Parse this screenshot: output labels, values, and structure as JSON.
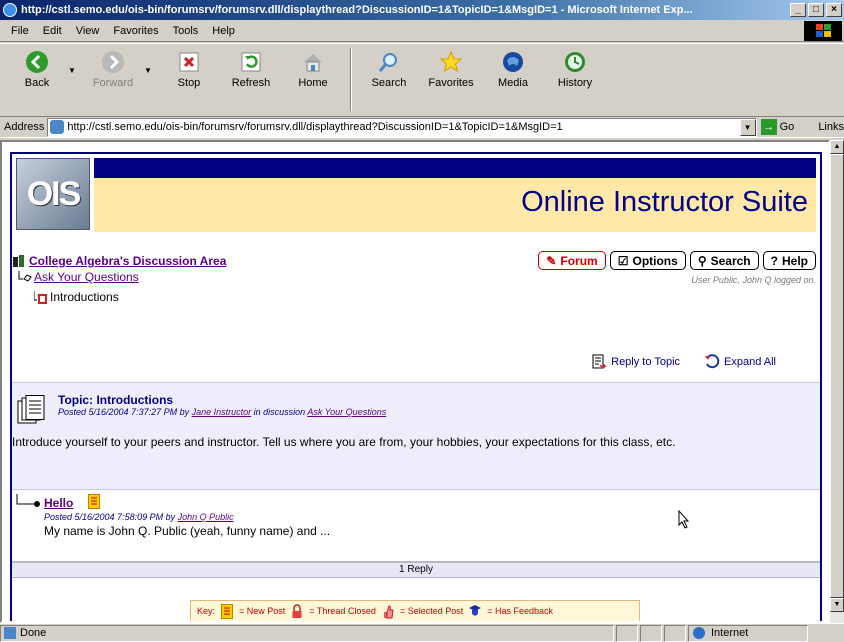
{
  "window": {
    "title": "http://cstl.semo.edu/ois-bin/forumsrv/forumsrv.dll/displaythread?DiscussionID=1&TopicID=1&MsgID=1 - Microsoft Internet Exp..."
  },
  "menu": [
    "File",
    "Edit",
    "View",
    "Favorites",
    "Tools",
    "Help"
  ],
  "toolbar": {
    "back": "Back",
    "forward": "Forward",
    "stop": "Stop",
    "refresh": "Refresh",
    "home": "Home",
    "search": "Search",
    "favorites": "Favorites",
    "media": "Media",
    "history": "History"
  },
  "address": {
    "label": "Address",
    "url": "http://cstl.semo.edu/ois-bin/forumsrv/forumsrv.dll/displaythread?DiscussionID=1&TopicID=1&MsgID=1",
    "go": "Go",
    "links": "Links"
  },
  "banner": {
    "logo": "OIS",
    "title": "Online Instructor Suite"
  },
  "nav": {
    "discussion_area": "College Algebra's Discussion Area",
    "ask": "Ask Your Questions",
    "introductions": "Introductions",
    "forum": "Forum",
    "options": "Options",
    "search": "Search",
    "help": "Help",
    "logged_on": "User Public, John Q logged on."
  },
  "actions": {
    "reply": "Reply to Topic",
    "expand": "Expand All"
  },
  "topic": {
    "title": "Topic: Introductions",
    "posted_prefix": "Posted  5/16/2004 7:37:27 PM by ",
    "author": "Jane Instructor",
    "in_discussion": " in discussion ",
    "discussion": "Ask Your Questions",
    "body": "Introduce yourself to your peers and instructor.  Tell us where you are from, your hobbies, your expectations for this class, etc."
  },
  "reply": {
    "title": "Hello",
    "posted_prefix": "Posted  5/16/2004 7:58:09 PM by ",
    "author": "John Q Public",
    "body": "My name is John Q. Public (yeah, funny name) and ..."
  },
  "replies_count": "1 Reply",
  "key": {
    "label": "Key:",
    "new_post": "= New Post",
    "thread_closed": "= Thread Closed",
    "selected_post": "= Selected Post",
    "has_feedback": "= Has Feedback"
  },
  "status": {
    "text": "Done",
    "zone": "Internet"
  },
  "colors": {
    "banner_blue": "#000080",
    "banner_yellow": "#ffe8a8",
    "link_purple": "#5a0082",
    "title_navy": "#00008a",
    "forum_red": "#cc0000"
  }
}
